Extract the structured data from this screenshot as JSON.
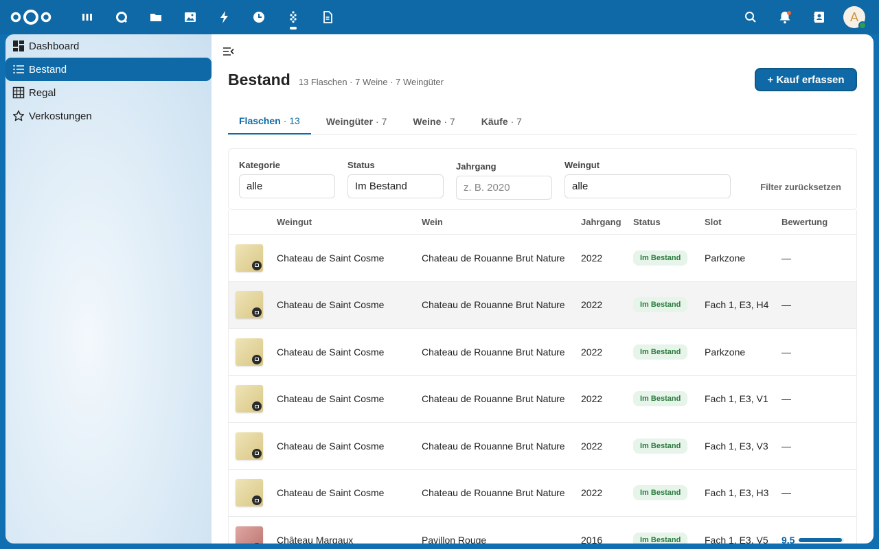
{
  "topbar": {
    "apps": [
      {
        "name": "dashboard-app-icon",
        "icon": "grid-icon"
      },
      {
        "name": "search-app-icon",
        "icon": "circle-icon"
      },
      {
        "name": "files-app-icon",
        "icon": "folder-icon"
      },
      {
        "name": "photos-app-icon",
        "icon": "image-icon"
      },
      {
        "name": "activity-app-icon",
        "icon": "bolt-icon"
      },
      {
        "name": "clock-app-icon",
        "icon": "clock-icon"
      },
      {
        "name": "wine-app-icon",
        "icon": "grape-icon",
        "active": true
      },
      {
        "name": "notes-app-icon",
        "icon": "document-icon"
      }
    ],
    "avatar_initial": "A"
  },
  "sidebar": {
    "items": [
      {
        "label": "Dashboard",
        "icon": "dashboard-icon"
      },
      {
        "label": "Bestand",
        "icon": "list-icon",
        "active": true
      },
      {
        "label": "Regal",
        "icon": "grid-table-icon"
      },
      {
        "label": "Verkostungen",
        "icon": "star-icon"
      }
    ]
  },
  "page": {
    "title": "Bestand",
    "subtitle": "13 Flaschen · 7 Weine · 7 Weingüter",
    "primary_button": "+ Kauf erfassen"
  },
  "tabs": [
    {
      "label": "Flaschen",
      "count": "· 13",
      "active": true
    },
    {
      "label": "Weingüter",
      "count": "· 7"
    },
    {
      "label": "Weine",
      "count": "· 7"
    },
    {
      "label": "Käufe",
      "count": "· 7"
    }
  ],
  "filters": {
    "kategorie": {
      "label": "Kategorie",
      "value": "alle"
    },
    "status": {
      "label": "Status",
      "value": "Im Bestand"
    },
    "jahrgang": {
      "label": "Jahrgang",
      "placeholder": "z. B. 2020"
    },
    "weingut": {
      "label": "Weingut",
      "value": "alle"
    },
    "reset": "Filter zurücksetzen"
  },
  "table": {
    "headers": [
      "Weingut",
      "Wein",
      "Jahrgang",
      "Status",
      "Slot",
      "Bewertung"
    ],
    "rows": [
      {
        "weingut": "Chateau de Saint Cosme",
        "wein": "Chateau de Rouanne Brut Nature",
        "jahrgang": "2022",
        "status": "Im Bestand",
        "slot": "Parkzone",
        "bewertung": "—",
        "thumb": "gold"
      },
      {
        "weingut": "Chateau de Saint Cosme",
        "wein": "Chateau de Rouanne Brut Nature",
        "jahrgang": "2022",
        "status": "Im Bestand",
        "slot": "Fach 1, E3, H4",
        "bewertung": "—",
        "thumb": "gold",
        "hover": true
      },
      {
        "weingut": "Chateau de Saint Cosme",
        "wein": "Chateau de Rouanne Brut Nature",
        "jahrgang": "2022",
        "status": "Im Bestand",
        "slot": "Parkzone",
        "bewertung": "—",
        "thumb": "gold"
      },
      {
        "weingut": "Chateau de Saint Cosme",
        "wein": "Chateau de Rouanne Brut Nature",
        "jahrgang": "2022",
        "status": "Im Bestand",
        "slot": "Fach 1, E3, V1",
        "bewertung": "—",
        "thumb": "gold"
      },
      {
        "weingut": "Chateau de Saint Cosme",
        "wein": "Chateau de Rouanne Brut Nature",
        "jahrgang": "2022",
        "status": "Im Bestand",
        "slot": "Fach 1, E3, V3",
        "bewertung": "—",
        "thumb": "gold"
      },
      {
        "weingut": "Chateau de Saint Cosme",
        "wein": "Chateau de Rouanne Brut Nature",
        "jahrgang": "2022",
        "status": "Im Bestand",
        "slot": "Fach 1, E3, H3",
        "bewertung": "—",
        "thumb": "gold"
      },
      {
        "weingut": "Château Margaux",
        "wein": "Pavillon Rouge",
        "jahrgang": "2016",
        "status": "Im Bestand",
        "slot": "Fach 1, E3, V5",
        "bewertung": "9.5",
        "rating_fraction": 0.95,
        "thumb": "red"
      }
    ]
  },
  "colors": {
    "accent": "#0e69a6",
    "badge_bg": "#e6f4ea",
    "badge_text": "#2c7a3e"
  }
}
